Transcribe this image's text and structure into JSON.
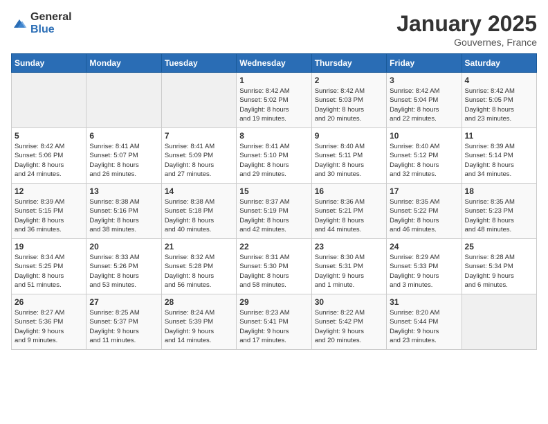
{
  "logo": {
    "general": "General",
    "blue": "Blue"
  },
  "title": "January 2025",
  "subtitle": "Gouvernes, France",
  "weekdays": [
    "Sunday",
    "Monday",
    "Tuesday",
    "Wednesday",
    "Thursday",
    "Friday",
    "Saturday"
  ],
  "weeks": [
    [
      {
        "day": "",
        "info": ""
      },
      {
        "day": "",
        "info": ""
      },
      {
        "day": "",
        "info": ""
      },
      {
        "day": "1",
        "info": "Sunrise: 8:42 AM\nSunset: 5:02 PM\nDaylight: 8 hours\nand 19 minutes."
      },
      {
        "day": "2",
        "info": "Sunrise: 8:42 AM\nSunset: 5:03 PM\nDaylight: 8 hours\nand 20 minutes."
      },
      {
        "day": "3",
        "info": "Sunrise: 8:42 AM\nSunset: 5:04 PM\nDaylight: 8 hours\nand 22 minutes."
      },
      {
        "day": "4",
        "info": "Sunrise: 8:42 AM\nSunset: 5:05 PM\nDaylight: 8 hours\nand 23 minutes."
      }
    ],
    [
      {
        "day": "5",
        "info": "Sunrise: 8:42 AM\nSunset: 5:06 PM\nDaylight: 8 hours\nand 24 minutes."
      },
      {
        "day": "6",
        "info": "Sunrise: 8:41 AM\nSunset: 5:07 PM\nDaylight: 8 hours\nand 26 minutes."
      },
      {
        "day": "7",
        "info": "Sunrise: 8:41 AM\nSunset: 5:09 PM\nDaylight: 8 hours\nand 27 minutes."
      },
      {
        "day": "8",
        "info": "Sunrise: 8:41 AM\nSunset: 5:10 PM\nDaylight: 8 hours\nand 29 minutes."
      },
      {
        "day": "9",
        "info": "Sunrise: 8:40 AM\nSunset: 5:11 PM\nDaylight: 8 hours\nand 30 minutes."
      },
      {
        "day": "10",
        "info": "Sunrise: 8:40 AM\nSunset: 5:12 PM\nDaylight: 8 hours\nand 32 minutes."
      },
      {
        "day": "11",
        "info": "Sunrise: 8:39 AM\nSunset: 5:14 PM\nDaylight: 8 hours\nand 34 minutes."
      }
    ],
    [
      {
        "day": "12",
        "info": "Sunrise: 8:39 AM\nSunset: 5:15 PM\nDaylight: 8 hours\nand 36 minutes."
      },
      {
        "day": "13",
        "info": "Sunrise: 8:38 AM\nSunset: 5:16 PM\nDaylight: 8 hours\nand 38 minutes."
      },
      {
        "day": "14",
        "info": "Sunrise: 8:38 AM\nSunset: 5:18 PM\nDaylight: 8 hours\nand 40 minutes."
      },
      {
        "day": "15",
        "info": "Sunrise: 8:37 AM\nSunset: 5:19 PM\nDaylight: 8 hours\nand 42 minutes."
      },
      {
        "day": "16",
        "info": "Sunrise: 8:36 AM\nSunset: 5:21 PM\nDaylight: 8 hours\nand 44 minutes."
      },
      {
        "day": "17",
        "info": "Sunrise: 8:35 AM\nSunset: 5:22 PM\nDaylight: 8 hours\nand 46 minutes."
      },
      {
        "day": "18",
        "info": "Sunrise: 8:35 AM\nSunset: 5:23 PM\nDaylight: 8 hours\nand 48 minutes."
      }
    ],
    [
      {
        "day": "19",
        "info": "Sunrise: 8:34 AM\nSunset: 5:25 PM\nDaylight: 8 hours\nand 51 minutes."
      },
      {
        "day": "20",
        "info": "Sunrise: 8:33 AM\nSunset: 5:26 PM\nDaylight: 8 hours\nand 53 minutes."
      },
      {
        "day": "21",
        "info": "Sunrise: 8:32 AM\nSunset: 5:28 PM\nDaylight: 8 hours\nand 56 minutes."
      },
      {
        "day": "22",
        "info": "Sunrise: 8:31 AM\nSunset: 5:30 PM\nDaylight: 8 hours\nand 58 minutes."
      },
      {
        "day": "23",
        "info": "Sunrise: 8:30 AM\nSunset: 5:31 PM\nDaylight: 9 hours\nand 1 minute."
      },
      {
        "day": "24",
        "info": "Sunrise: 8:29 AM\nSunset: 5:33 PM\nDaylight: 9 hours\nand 3 minutes."
      },
      {
        "day": "25",
        "info": "Sunrise: 8:28 AM\nSunset: 5:34 PM\nDaylight: 9 hours\nand 6 minutes."
      }
    ],
    [
      {
        "day": "26",
        "info": "Sunrise: 8:27 AM\nSunset: 5:36 PM\nDaylight: 9 hours\nand 9 minutes."
      },
      {
        "day": "27",
        "info": "Sunrise: 8:25 AM\nSunset: 5:37 PM\nDaylight: 9 hours\nand 11 minutes."
      },
      {
        "day": "28",
        "info": "Sunrise: 8:24 AM\nSunset: 5:39 PM\nDaylight: 9 hours\nand 14 minutes."
      },
      {
        "day": "29",
        "info": "Sunrise: 8:23 AM\nSunset: 5:41 PM\nDaylight: 9 hours\nand 17 minutes."
      },
      {
        "day": "30",
        "info": "Sunrise: 8:22 AM\nSunset: 5:42 PM\nDaylight: 9 hours\nand 20 minutes."
      },
      {
        "day": "31",
        "info": "Sunrise: 8:20 AM\nSunset: 5:44 PM\nDaylight: 9 hours\nand 23 minutes."
      },
      {
        "day": "",
        "info": ""
      }
    ]
  ]
}
